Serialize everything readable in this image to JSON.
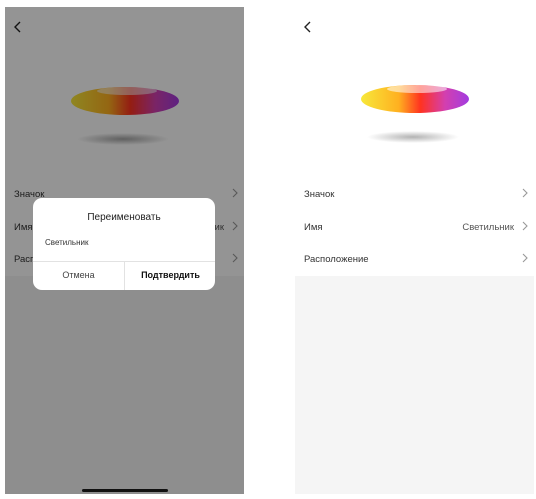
{
  "right_screen": {
    "rows": [
      {
        "label": "Значок",
        "value": ""
      },
      {
        "label": "Имя",
        "value": "Светильник"
      },
      {
        "label": "Расположение",
        "value": ""
      }
    ]
  },
  "left_screen": {
    "rows": [
      {
        "label": "Значок",
        "value": ""
      },
      {
        "label": "Имя",
        "value": "Светильник"
      },
      {
        "label": "Расположение",
        "value": ""
      }
    ],
    "dialog": {
      "title": "Переименовать",
      "input_value": "Светильник",
      "cancel_label": "Отмена",
      "confirm_label": "Подтвердить"
    }
  },
  "icons": {
    "back": "chevron-left-icon",
    "row_arrow": "chevron-right-icon",
    "device": "ceiling-lamp-image"
  },
  "colors": {
    "overlay": "#00000069",
    "content_bg": "#f5f5f5",
    "lamp_gradient": [
      "#f5e23b",
      "#ff3b1f",
      "#a93de0"
    ]
  }
}
